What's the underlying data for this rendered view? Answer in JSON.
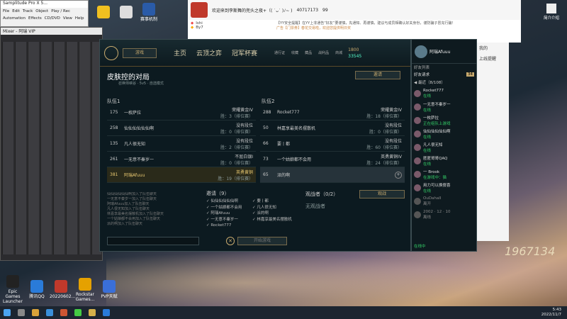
{
  "samplitude": {
    "title": "Samplitude Pro X 5...",
    "menus": [
      "File",
      "Edit",
      "Track",
      "Object",
      "Play / Rec",
      "Automation",
      "Effects",
      "CD/DVD",
      "View",
      "Help"
    ],
    "mixer_title": "Mixer - 阿瑞 VIP"
  },
  "qq": {
    "title": "欢迎来到李斯舞的兜头之夜+（( ˙ᴗ˙ )ﾉ~ )",
    "id": "40717173",
    "count": "99",
    "msg1": "【YY安全提醒】在YY上非通告“好友”要谨慎，先通知、再谨慎，建议与成员相确认好关身份，谨防骗子冒充行骗！",
    "msg2": "广告【门票券】春花交易啦，欢迎您提供明日奖",
    "user1": "Ishi",
    "user2": "By7"
  },
  "desktop_icons": [
    {
      "label": "Epic Games Launcher",
      "color": "#222"
    },
    {
      "label": "腾讯QQ",
      "color": "#2a7bd9"
    },
    {
      "label": "20220602...",
      "color": "#c0392b"
    },
    {
      "label": "Rockstar Games...",
      "color": "#e5a100"
    },
    {
      "label": "PVP天赋",
      "color": "#3a6fd8"
    }
  ],
  "desktop_top_icons": [
    {
      "label": "",
      "color": "#f0c020"
    },
    {
      "label": "",
      "color": "#ddd"
    },
    {
      "label": "赛事机制",
      "color": "#2a5ba8"
    }
  ],
  "client": {
    "nav": {
      "search": "游戏",
      "tabs": [
        "主页",
        "云顶之弈",
        "冠军杯赛"
      ],
      "icons": [
        "通行证",
        "收藏",
        "藏品",
        "战利品",
        "商城"
      ],
      "rp": "1800",
      "be": "33545",
      "summoner": "阿瑞Afuuu"
    },
    "lobby": {
      "title": "皮肤控的对局",
      "subtitle": "召唤师峡谷 · 5v5 · 自选模式",
      "invite_btn": "邀请"
    },
    "team1_label": "队伍1",
    "team2_label": "队伍2",
    "team1": [
      {
        "level": "175",
        "name": "一枚萨拉",
        "rank": "荣耀黄金IV",
        "lp": "胜：3（排位赛）"
      },
      {
        "level": "258",
        "name": "仙仙仙仙仙仙啊",
        "rank": "没有段位",
        "lp": "胜：0（排位赛）"
      },
      {
        "level": "135",
        "name": "凡人很无知",
        "rank": "没有段位",
        "lp": "胜：2（排位赛）"
      },
      {
        "level": "261",
        "name": "一无意不秦岁一",
        "rank": "不屈白银I",
        "lp": "胜：0（排位赛）"
      },
      {
        "level": "381",
        "name": "阿瑞Afuuu",
        "rank": "英勇黄铜",
        "lp": "胜：19（排位赛）"
      }
    ],
    "team2": [
      {
        "level": "288",
        "name": "Rocket777",
        "rank": "荣耀黄金IV",
        "lp": "胜：18（排位赛）"
      },
      {
        "level": "50",
        "name": "林嘉享最美名摆散机",
        "rank": "没有段位",
        "lp": "胜：0（排位赛）"
      },
      {
        "level": "66",
        "name": "要丨都",
        "rank": "没有段位",
        "lp": "胜：60（排位赛）"
      },
      {
        "level": "73",
        "name": "一个姑娘都不会用",
        "rank": "英勇黄铜IV",
        "lp": "胜：24（排位赛）"
      },
      {
        "level": "65",
        "name": "派的啊"
      }
    ],
    "chat_lines": [
      "仙仙仙仙仙仙啊加入了队伍聊天",
      "一无意不秦岁一加入了队伍聊天",
      "阿瑞Afuuu加入了队伍聊天",
      "凡人很无知加入了队伍聊天",
      "林嘉享最美名摆散机加入了队伍聊天",
      "一个姑娘都不会用加入了队伍聊天",
      "派的啊加入了队伍聊天"
    ],
    "invited_label": "邀请（9）",
    "invited": [
      "仙仙仙仙仙仙啊",
      "一个姑娘都不会用",
      "阿瑞Afuuu",
      "一无意不秦岁一",
      "Rocket777",
      "要丨都",
      "凡人很无知",
      "派的啊",
      "林嘉享最美名摆散机"
    ],
    "spectators_label": "观战者（0/2）",
    "spectators_empty": "无观战者",
    "spectate_btn": "观战",
    "start_btn": "开始游戏"
  },
  "friends": {
    "header": "好友列表",
    "add_label": "好友请求",
    "count_badge": "34",
    "group": "◀ 最近（8/108）",
    "list": [
      {
        "name": "Rocket777",
        "status": "在线"
      },
      {
        "name": "一无意不秦岁一",
        "status": "在线"
      },
      {
        "name": "一枚萨拉",
        "status": "正在组队上游戏"
      },
      {
        "name": "仙仙仙仙仙仙啊",
        "status": "在线"
      },
      {
        "name": "凡人很无知",
        "status": "在线"
      },
      {
        "name": "匿匿哥哥QAQ",
        "status": "在线"
      },
      {
        "name": "一 Brook",
        "status": "在游戏中：猫"
      },
      {
        "name": "用力可以换傻喜",
        "status": "在线"
      },
      {
        "name": "OuDahaII",
        "status": "离开"
      },
      {
        "name": "2002 · 12 · 10",
        "status": "离线"
      }
    ],
    "footer_label": "在线中"
  },
  "side_panel": {
    "top": "我的",
    "mid": "上线提醒",
    "bottom": "简介介绍"
  },
  "overlay_text": "1967134",
  "taskbar": {
    "time": "5:43",
    "date": "2022/11/7",
    "lang": "中"
  }
}
